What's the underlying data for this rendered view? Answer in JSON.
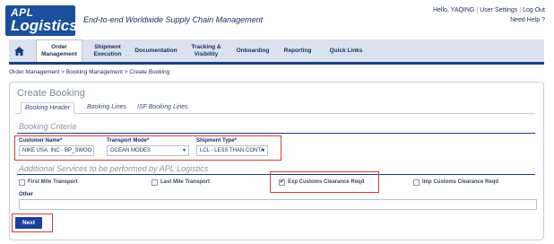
{
  "header": {
    "logo_line1": "APL",
    "logo_line2": "Logistics",
    "tagline": "End-to-end Worldwide Supply Chain Management",
    "greeting": "Hello, YAQING",
    "user_settings": "User Settings",
    "logout": "Log Out",
    "need_help": "Need Help ?"
  },
  "nav": {
    "items": [
      {
        "label": "Order\nManagement"
      },
      {
        "label": "Shipment\nExecution"
      },
      {
        "label": "Documentation"
      },
      {
        "label": "Tracking &\nVisibility"
      },
      {
        "label": "Onboarding"
      },
      {
        "label": "Reporting"
      },
      {
        "label": "Quick Links"
      }
    ]
  },
  "breadcrumb": "Order Management > Booking Management > Create Booking",
  "page": {
    "title": "Create Booking",
    "tabs": [
      {
        "label": "Booking Header"
      },
      {
        "label": "Booking Lines"
      },
      {
        "label": "ISF Booking Lines"
      }
    ],
    "booking_criteria": {
      "heading": "Booking Criteria",
      "customer_name_label": "Customer Name*",
      "customer_name_value": "NIKE USA, INC - BP_SWOO",
      "transport_mode_label": "Transport Mode*",
      "transport_mode_value": "OCEAN MODES",
      "shipment_type_label": "Shipment Type*",
      "shipment_type_value": "LCL - LESS THAN CONTA"
    },
    "additional_services": {
      "heading": "Additional Services to be performed by APL Logistics",
      "options": [
        {
          "label": "First Mile Transport",
          "checked": false
        },
        {
          "label": "Last Mile Transport",
          "checked": false
        },
        {
          "label": "Exp Customs Clearance Reqd",
          "checked": true
        },
        {
          "label": "Imp Customs Clearance Reqd",
          "checked": false
        }
      ],
      "other_label": "Other",
      "other_value": ""
    },
    "next_label": "Next"
  },
  "colors": {
    "brand": "#1b4f9c",
    "nav_bg": "#dbe2ee",
    "highlight": "#d93b3b"
  }
}
